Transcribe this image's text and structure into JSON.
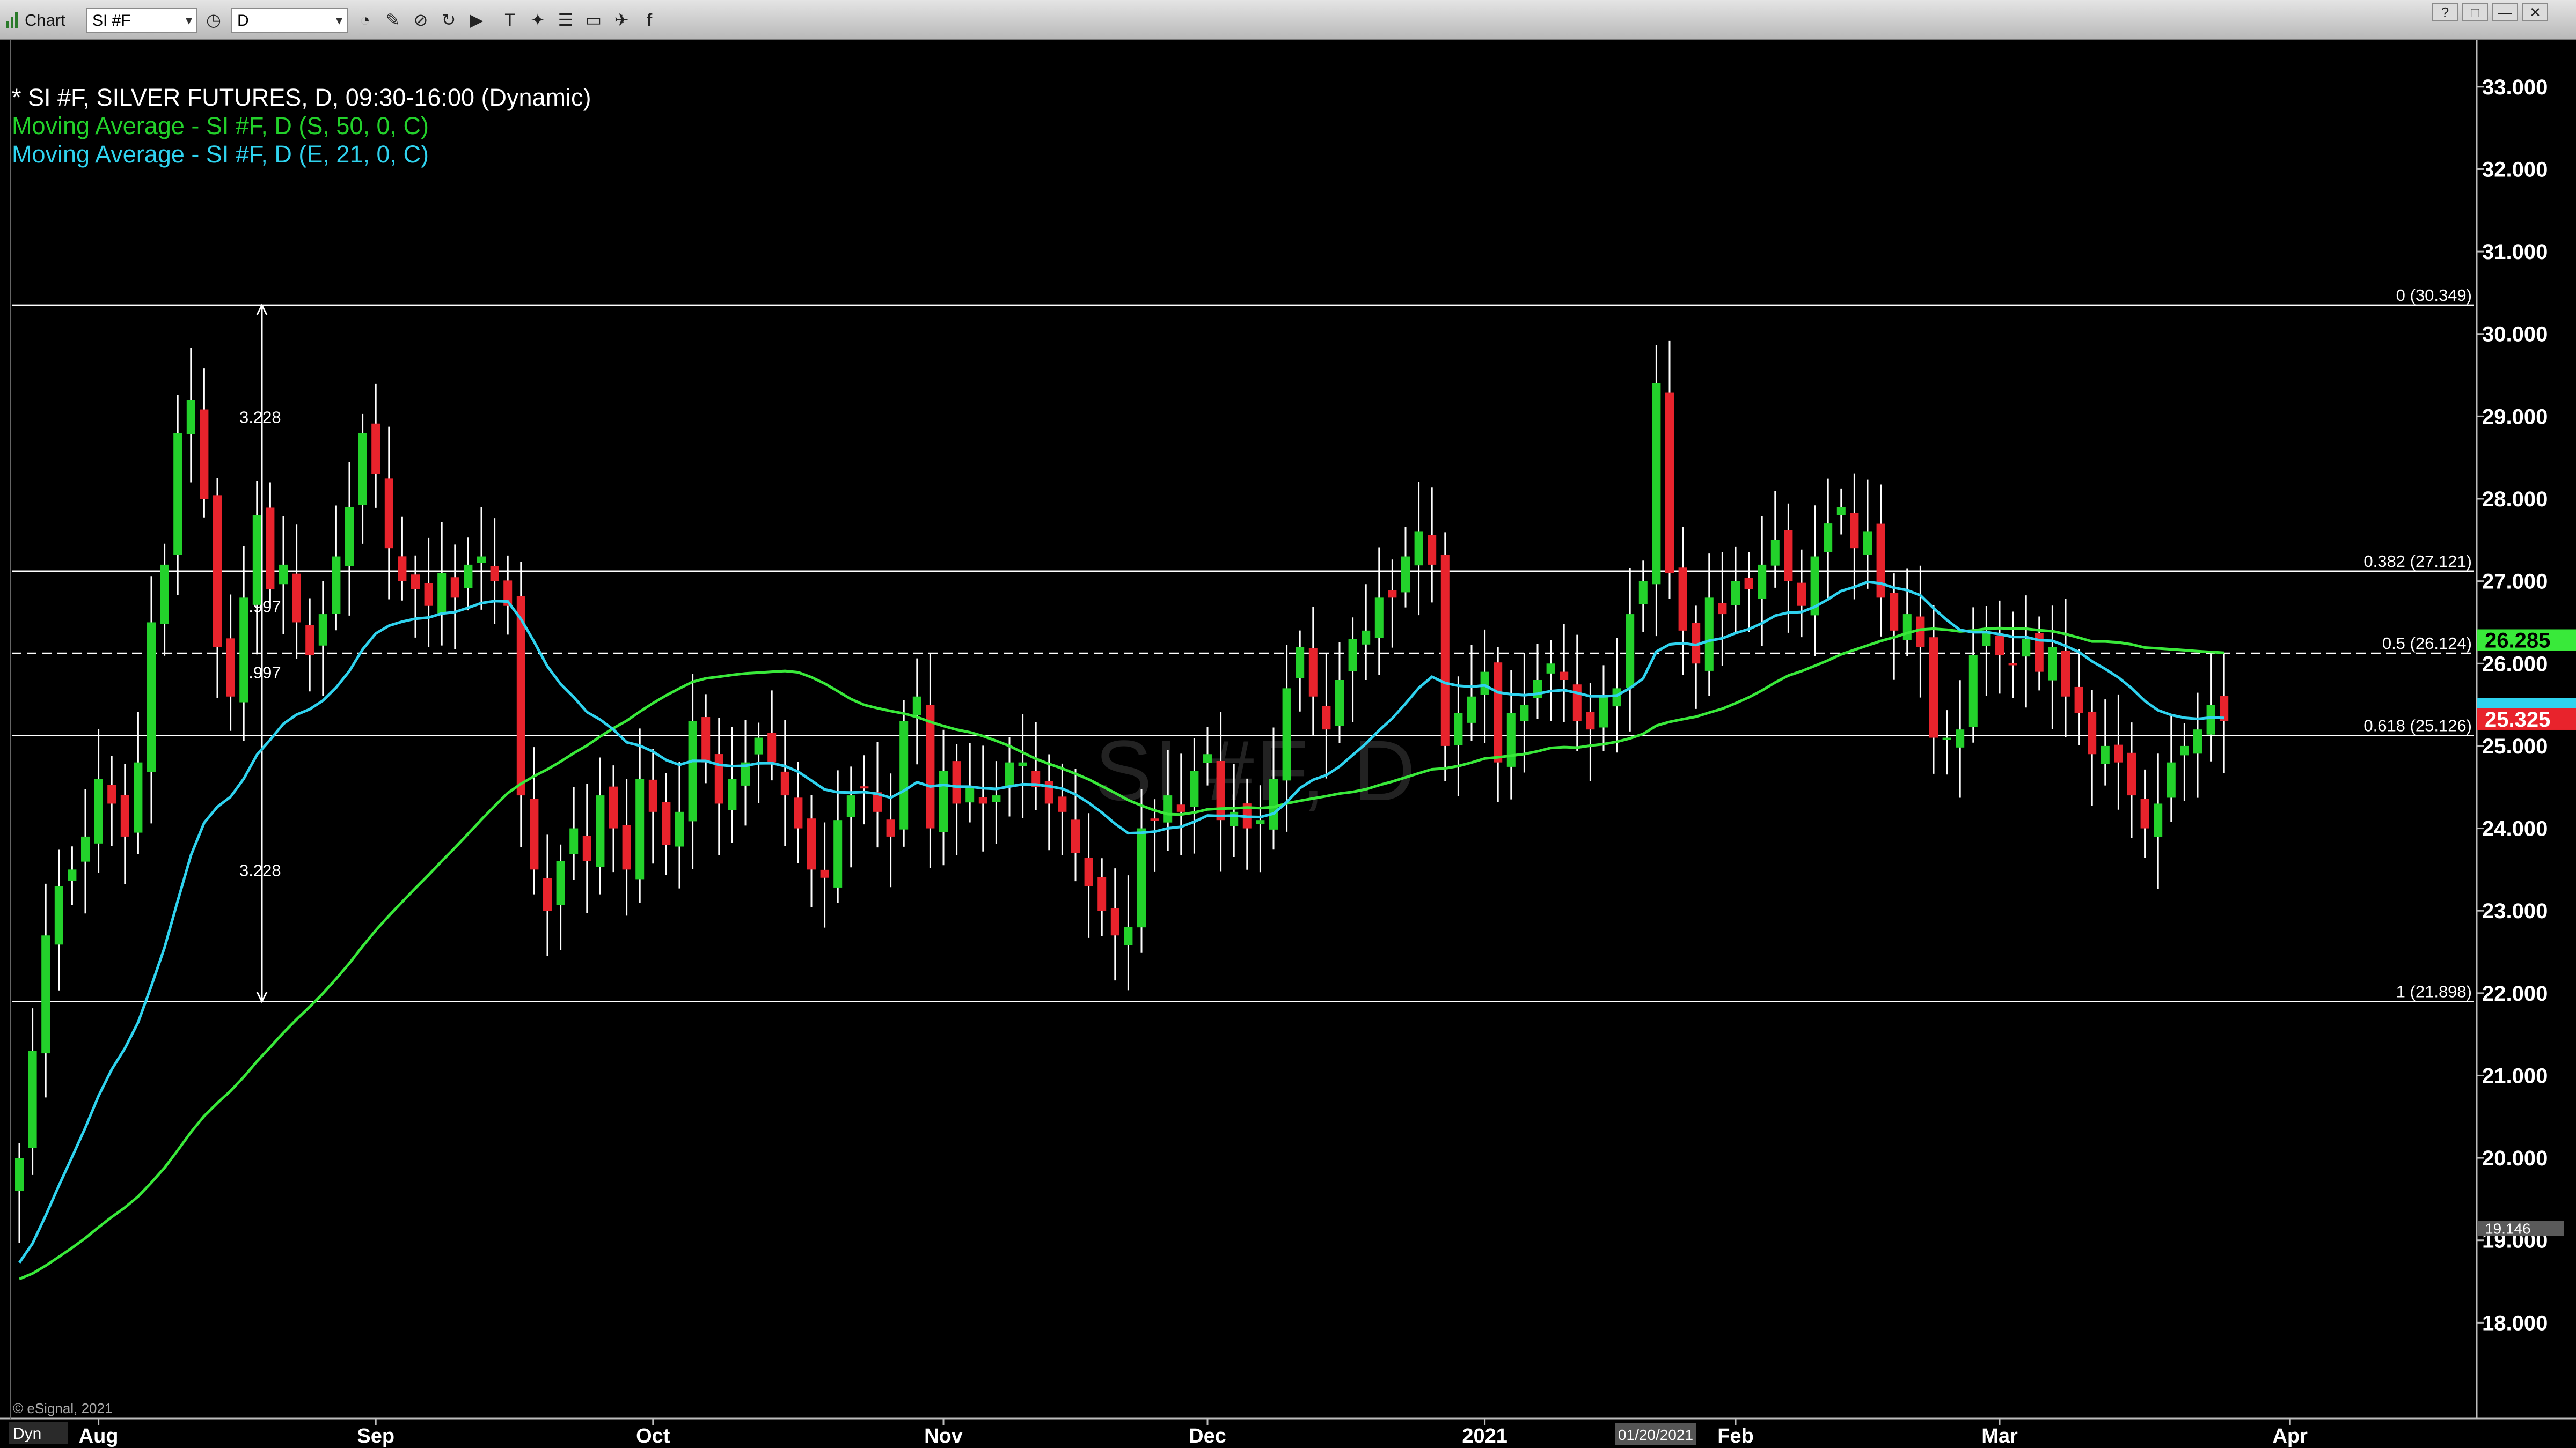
{
  "toolbar": {
    "app_label": "Chart",
    "symbol_value": "SI #F",
    "interval_value": "D",
    "icons": [
      "clock-icon",
      "pencil-icon",
      "link-icon",
      "refresh-icon",
      "play-icon",
      "text-icon",
      "settings-icon",
      "chat-icon",
      "twitter-icon",
      "facebook-icon"
    ],
    "window_buttons": [
      "?",
      "□",
      "—",
      "✕"
    ]
  },
  "legend": {
    "title": "* SI #F, SILVER FUTURES, D, 09:30-16:00 (Dynamic)",
    "sma": "Moving Average - SI #F, D (S, 50, 0, C)",
    "ema": "Moving Average - SI #F, D (E, 21, 0, C)"
  },
  "watermark": "SI #F, D",
  "copyright": "© eSignal, 2021",
  "dyn_label": "Dyn",
  "date_highlight": "01/20/2021",
  "badges": {
    "sma_value": "26.285",
    "last_price": "25.325",
    "low_marker": "19.146"
  },
  "colors": {
    "up": "#23d12b",
    "down": "#e8232c",
    "sma": "#39e93a",
    "ema": "#2fd3ef",
    "wick": "#ffffff"
  },
  "fibonacci": [
    {
      "level": 30.349,
      "label": "0 (30.349)"
    },
    {
      "level": 27.121,
      "label": "0.382 (27.121)"
    },
    {
      "level": 26.124,
      "label": "0.5 (26.124)"
    },
    {
      "level": 25.126,
      "label": "0.618 (25.126)"
    },
    {
      "level": 21.898,
      "label": "1 (21.898)"
    }
  ],
  "measure_labels": [
    "3.228",
    "0.997",
    "0.997",
    "3.228"
  ],
  "chart_data": {
    "type": "candlestick",
    "ylim": [
      17.0,
      33.5
    ],
    "y_ticks": [
      "18.000",
      "19.000",
      "20.000",
      "21.000",
      "22.000",
      "23.000",
      "24.000",
      "25.000",
      "26.000",
      "27.000",
      "28.000",
      "29.000",
      "30.000",
      "31.000",
      "32.000",
      "33.000"
    ],
    "x_ticks": [
      {
        "label": "Aug",
        "index": 6
      },
      {
        "label": "Sep",
        "index": 27
      },
      {
        "label": "Oct",
        "index": 48
      },
      {
        "label": "Nov",
        "index": 70
      },
      {
        "label": "Dec",
        "index": 90
      },
      {
        "label": "2021",
        "index": 111
      },
      {
        "label": "Feb",
        "index": 130
      },
      {
        "label": "Mar",
        "index": 150
      },
      {
        "label": "Apr",
        "index": 172
      }
    ],
    "closes": [
      20.0,
      21.3,
      22.7,
      23.3,
      23.5,
      23.9,
      24.6,
      24.3,
      23.9,
      24.8,
      26.5,
      27.2,
      28.8,
      29.2,
      28.0,
      26.2,
      25.6,
      26.8,
      27.8,
      26.9,
      27.2,
      26.5,
      26.1,
      26.6,
      27.3,
      27.9,
      28.8,
      28.3,
      27.4,
      27.0,
      26.9,
      26.7,
      27.1,
      26.8,
      27.2,
      27.3,
      27.0,
      26.7,
      24.4,
      23.5,
      23.0,
      23.6,
      24.0,
      23.6,
      24.4,
      24.0,
      23.5,
      24.6,
      24.2,
      23.8,
      24.2,
      25.3,
      24.8,
      24.3,
      24.6,
      24.8,
      25.1,
      24.8,
      24.4,
      24.0,
      23.5,
      23.4,
      24.1,
      24.4,
      24.5,
      24.2,
      23.9,
      25.3,
      25.6,
      24.0,
      24.7,
      24.3,
      24.5,
      24.3,
      24.4,
      24.8,
      24.8,
      24.5,
      24.3,
      24.2,
      23.7,
      23.3,
      23.0,
      22.7,
      22.8,
      24.0,
      24.1,
      24.4,
      24.2,
      24.7,
      24.9,
      24.1,
      24.2,
      24.0,
      24.1,
      24.6,
      25.7,
      26.2,
      25.6,
      25.2,
      25.8,
      26.3,
      26.4,
      26.8,
      26.8,
      27.3,
      27.6,
      27.2,
      25.0,
      25.4,
      25.6,
      25.9,
      24.8,
      25.4,
      25.5,
      25.8,
      26.0,
      25.8,
      25.3,
      25.2,
      25.6,
      25.7,
      26.6,
      27.0,
      29.4,
      27.1,
      26.4,
      26.0,
      26.8,
      26.6,
      27.0,
      26.9,
      27.2,
      27.5,
      27.0,
      26.7,
      27.3,
      27.7,
      27.9,
      27.4,
      27.6,
      26.8,
      26.4,
      26.6,
      26.2,
      25.1,
      25.1,
      25.2,
      26.1,
      26.4,
      26.1,
      26.0,
      26.3,
      25.9,
      26.2,
      25.6,
      25.4,
      24.9,
      25.0,
      24.8,
      24.4,
      24.0,
      24.3,
      24.8,
      25.0,
      25.2,
      25.5,
      25.3
    ]
  }
}
